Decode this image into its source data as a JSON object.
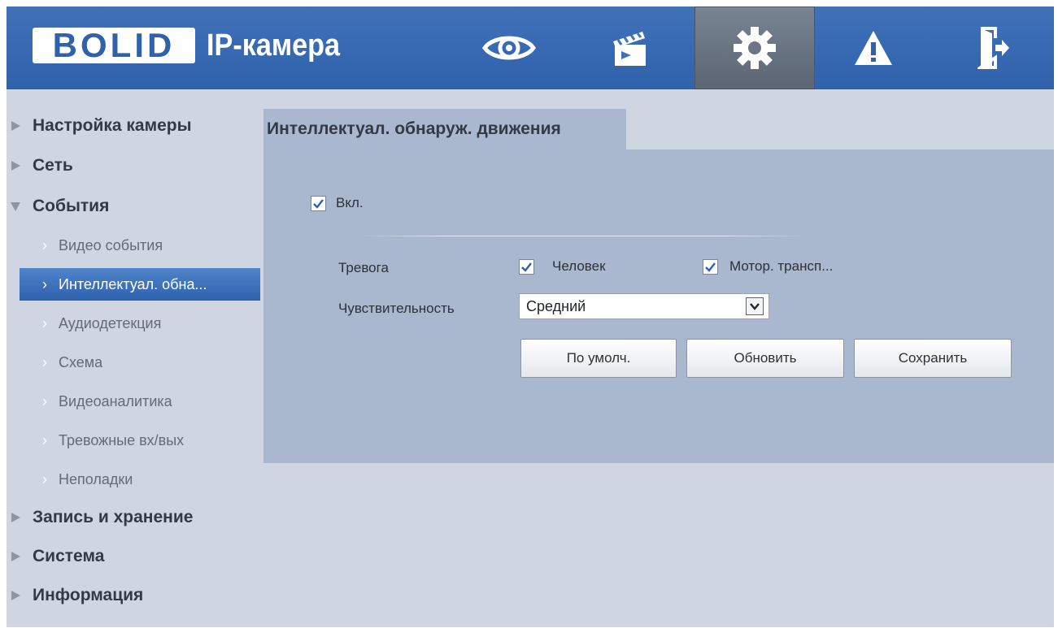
{
  "header": {
    "logo_text": "BOLID",
    "app_title": "IP-камера",
    "nav": [
      {
        "icon": "eye-icon",
        "label": "live-view"
      },
      {
        "icon": "clapperboard-icon",
        "label": "playback"
      },
      {
        "icon": "gear-icon",
        "label": "settings",
        "active": true
      },
      {
        "icon": "warning-icon",
        "label": "alarm"
      },
      {
        "icon": "logout-icon",
        "label": "logout"
      }
    ]
  },
  "sidebar": {
    "items": [
      {
        "label": "Настройка камеры",
        "level": "top",
        "expanded": false
      },
      {
        "label": "Сеть",
        "level": "top",
        "expanded": false
      },
      {
        "label": "События",
        "level": "top",
        "expanded": true
      },
      {
        "label": "Видео события",
        "level": "sub"
      },
      {
        "label": "Интеллектуал. обна...",
        "level": "sub",
        "selected": true
      },
      {
        "label": "Аудиодетекция",
        "level": "sub"
      },
      {
        "label": "Схема",
        "level": "sub"
      },
      {
        "label": "Видеоаналитика",
        "level": "sub"
      },
      {
        "label": "Тревожные вх/вых",
        "level": "sub"
      },
      {
        "label": "Неполадки",
        "level": "sub"
      },
      {
        "label": "Запись и хранение",
        "level": "top",
        "expanded": false
      },
      {
        "label": "Система",
        "level": "top",
        "expanded": false
      },
      {
        "label": "Информация",
        "level": "top",
        "expanded": false
      }
    ]
  },
  "panel": {
    "title": "Интеллектуал. обнаруж. движения",
    "enable": {
      "label": "Вкл.",
      "checked": true
    },
    "alarm": {
      "label": "Тревога",
      "person": {
        "label": "Человек",
        "checked": true
      },
      "vehicle": {
        "label": "Мотор. трансп...",
        "checked": true
      }
    },
    "sensitivity": {
      "label": "Чувствительность",
      "value": "Средний"
    },
    "buttons": {
      "default": "По умолч.",
      "refresh": "Обновить",
      "save": "Сохранить"
    }
  },
  "colors": {
    "header": "#2f62ab",
    "background": "#cfd6e2",
    "panel": "#a9b8cf",
    "selected": "#3a6fbb"
  }
}
